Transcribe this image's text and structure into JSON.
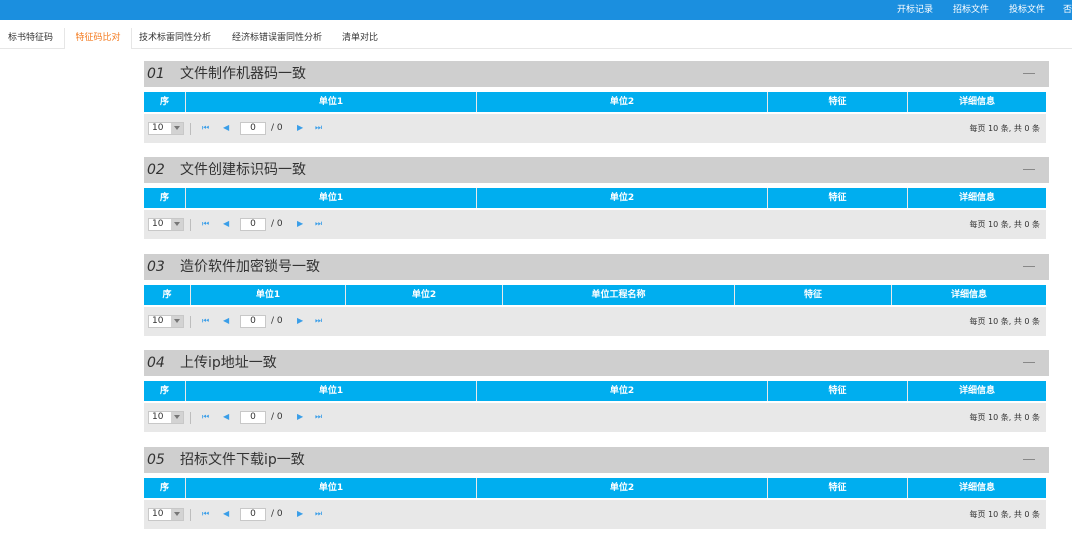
{
  "top_nav": [
    "开标记录",
    "招标文件",
    "投标文件",
    "否"
  ],
  "tabs": [
    "标书特征码",
    "特征码比对",
    "技术标雷同性分析",
    "经济标错误雷同性分析",
    "清单对比"
  ],
  "active_tab": 1,
  "pager": {
    "page_size": "10",
    "current_page": "0",
    "total_pages": "/ 0",
    "first": "⏮",
    "prev": "◀",
    "next": "▶",
    "last": "⏭",
    "summary": "每页 10 条, 共 0 条"
  },
  "sections": [
    {
      "num": "01",
      "title": "文件制作机器码一致",
      "columns": [
        "序",
        "单位1",
        "单位2",
        "特征",
        "详细信息"
      ]
    },
    {
      "num": "02",
      "title": "文件创建标识码一致",
      "columns": [
        "序",
        "单位1",
        "单位2",
        "特征",
        "详细信息"
      ]
    },
    {
      "num": "03",
      "title": "造价软件加密锁号一致",
      "columns": [
        "序",
        "单位1",
        "单位2",
        "单位工程名称",
        "特征",
        "详细信息"
      ]
    },
    {
      "num": "04",
      "title": "上传ip地址一致",
      "columns": [
        "序",
        "单位1",
        "单位2",
        "特征",
        "详细信息"
      ]
    },
    {
      "num": "05",
      "title": "招标文件下载ip一致",
      "columns": [
        "序",
        "单位1",
        "单位2",
        "特征",
        "详细信息"
      ]
    }
  ],
  "colors": {
    "topbar": "#1b8fdf",
    "header": "#00aeef",
    "active_tab": "#f47b20",
    "section_head": "#cfcfcf"
  }
}
